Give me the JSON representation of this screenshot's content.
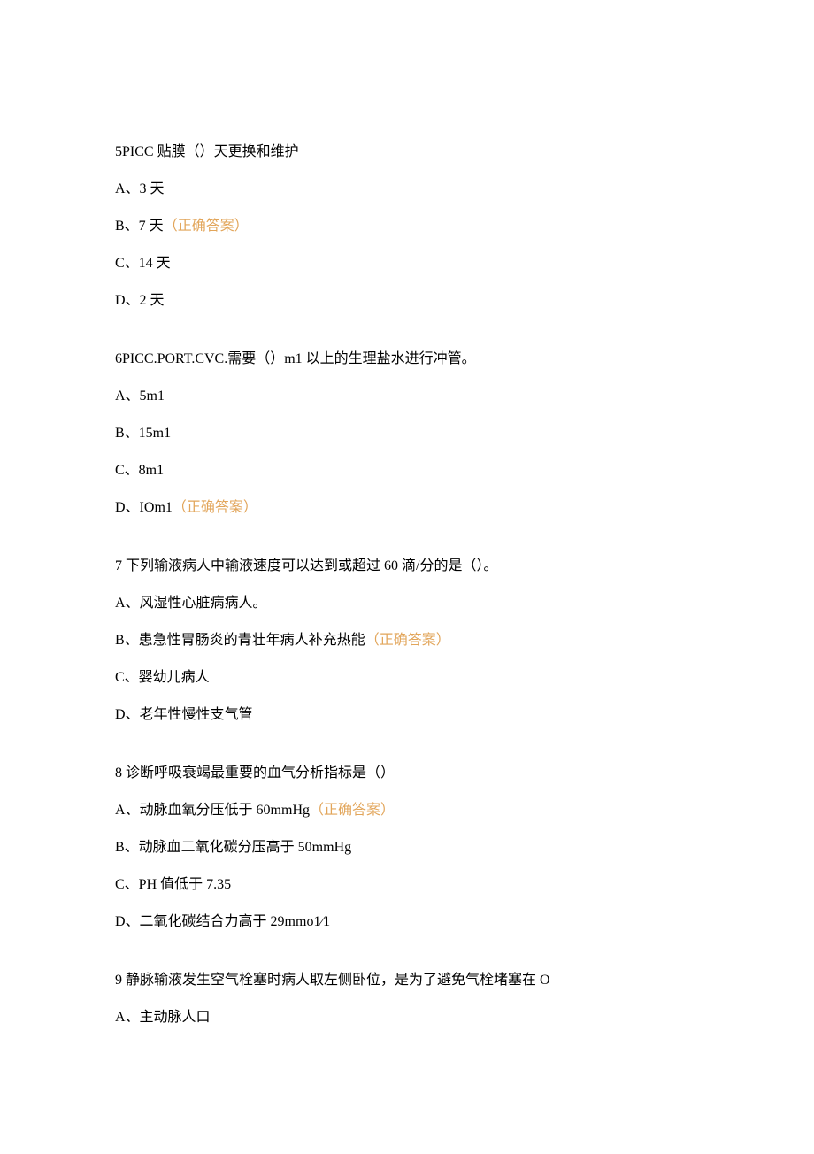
{
  "correct_label": "（正确答案）",
  "questions": [
    {
      "text": "5PICC 贴膜（）天更换和维护",
      "options": [
        {
          "label": "A、3 天",
          "correct": false
        },
        {
          "label": "B、7 天",
          "correct": true
        },
        {
          "label": "C、14 天",
          "correct": false
        },
        {
          "label": "D、2 天",
          "correct": false
        }
      ]
    },
    {
      "text": "6PICC.PORT.CVC.需要（）m1 以上的生理盐水进行冲管。",
      "options": [
        {
          "label": "A、5m1",
          "correct": false
        },
        {
          "label": "B、15m1",
          "correct": false
        },
        {
          "label": "C、8m1",
          "correct": false
        },
        {
          "label": "D、IOm1",
          "correct": true
        }
      ]
    },
    {
      "text": "7 下列输液病人中输液速度可以达到或超过 60 滴/分的是（）。",
      "options": [
        {
          "label": "A、风湿性心脏病病人。",
          "correct": false
        },
        {
          "label": "B、患急性胃肠炎的青壮年病人补充热能",
          "correct": true
        },
        {
          "label": "C、婴幼儿病人",
          "correct": false
        },
        {
          "label": "D、老年性慢性支气管",
          "correct": false
        }
      ]
    },
    {
      "text": "8 诊断呼吸衰竭最重要的血气分析指标是（）",
      "options": [
        {
          "label": "A、动脉血氧分压低于 60mmHg",
          "correct": true
        },
        {
          "label": "B、动脉血二氧化碳分压高于 50mmHg",
          "correct": false
        },
        {
          "label": "C、PH 值低于 7.35",
          "correct": false
        },
        {
          "label": "D、二氧化碳结合力高于 29mmo1∕1",
          "correct": false
        }
      ]
    },
    {
      "text": "9 静脉输液发生空气栓塞时病人取左侧卧位，是为了避免气栓堵塞在 O",
      "options": [
        {
          "label": "A、主动脉人口",
          "correct": false
        }
      ]
    }
  ]
}
